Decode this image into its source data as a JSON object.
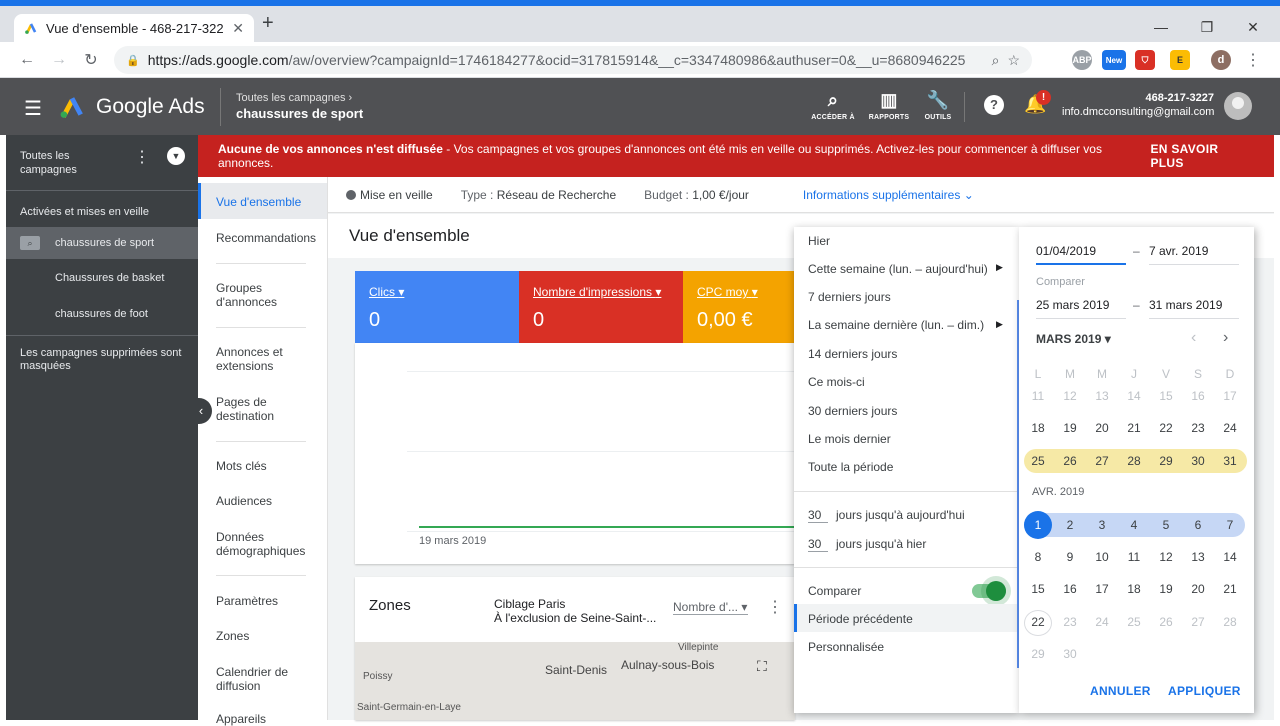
{
  "browser": {
    "tab_title": "Vue d'ensemble - 468-217-3227",
    "new_tab": "+",
    "url_base": "https://ads.google.com",
    "url_rest": "/aw/overview?campaignId=1746184277&ocid=317815914&__c=3347480986&authuser=0&__u=8680946225",
    "ext_new": "New",
    "profile": "d"
  },
  "header": {
    "app_name": "Google Ads",
    "breadcrumb_parent": "Toutes les campagnes",
    "breadcrumb_current": "chaussures de sport",
    "tools": [
      {
        "label": "ACCÉDER À",
        "icon": "search-icon"
      },
      {
        "label": "RAPPORTS",
        "icon": "reports-icon"
      },
      {
        "label": "OUTILS",
        "icon": "tools-icon"
      }
    ],
    "account_id": "468-217-3227",
    "account_email": "info.dmcconsulting@gmail.com",
    "notif_badge": "!"
  },
  "leftnav": {
    "all_campaigns_line1": "Toutes les",
    "all_campaigns_line2": "campagnes",
    "section": "Activées et mises en veille",
    "campaign_active": "chaussures de sport",
    "campaign_2": "Chaussures de basket",
    "campaign_3": "chaussures de foot",
    "removed_line1": "Les campagnes supprimées sont",
    "removed_line2": "masquées"
  },
  "alert": {
    "bold": "Aucune de vos annonces n'est diffusée",
    "text": " - Vos campagnes et vos groupes d'annonces ont été mis en veille ou supprimés. Activez-les pour commencer à diffuser vos annonces.",
    "link": "EN SAVOIR PLUS"
  },
  "subnav": [
    "Vue d'ensemble",
    "Recommandations",
    "Groupes d'annonces",
    "Annonces et extensions",
    "Pages de destination",
    "Mots clés",
    "Audiences",
    "Données démographiques",
    "Paramètres",
    "Zones",
    "Calendrier de diffusion",
    "Appareils"
  ],
  "status": {
    "state": "Mise en veille",
    "type_label": "Type : ",
    "type_value": "Réseau de Recherche",
    "budget_label": "Budget : ",
    "budget_value": "1,00 €/jour",
    "more": "Informations supplémentaires"
  },
  "page_title": "Vue d'ensemble",
  "metrics": [
    {
      "label": "Clics",
      "value": "0",
      "color": "#4285f4"
    },
    {
      "label": "Nombre d'impressions",
      "value": "0",
      "color": "#d93025"
    },
    {
      "label": "CPC moy",
      "value": "0,00 €",
      "color": "#f4a300"
    }
  ],
  "chart": {
    "date_label": "19 mars 2019",
    "line_color": "#34a853"
  },
  "zones": {
    "title": "Zones",
    "target_line1": "Ciblage Paris",
    "target_line2": "À l'exclusion de Seine-Saint-...",
    "metric_select": "Nombre d'...",
    "map_labels": [
      "Villepinte",
      "Saint-Denis",
      "Aulnay-sous-Bois",
      "Poissy",
      "Saint-Germain-en-Laye"
    ]
  },
  "presets": {
    "items": [
      {
        "label": "Hier",
        "arrow": false
      },
      {
        "label": "Cette semaine (lun. – aujourd'hui)",
        "arrow": true
      },
      {
        "label": "7 derniers jours",
        "arrow": false
      },
      {
        "label": "La semaine dernière (lun. – dim.)",
        "arrow": true
      },
      {
        "label": "14 derniers jours",
        "arrow": false
      },
      {
        "label": "Ce mois-ci",
        "arrow": false
      },
      {
        "label": "30 derniers jours",
        "arrow": false
      },
      {
        "label": "Le mois dernier",
        "arrow": false
      },
      {
        "label": "Toute la période",
        "arrow": false
      }
    ],
    "days_1": "30",
    "days_1_label": "jours jusqu'à aujourd'hui",
    "days_2": "30",
    "days_2_label": "jours jusqu'à hier",
    "compare": "Comparer",
    "compare_on": true,
    "previous": "Période précédente",
    "custom": "Personnalisée"
  },
  "calendar": {
    "start": "01/04/2019",
    "end": "7 avr. 2019",
    "compare_label": "Comparer",
    "compare_start": "25 mars 2019",
    "compare_end": "31 mars 2019",
    "dash": "–",
    "month_selector": "MARS 2019",
    "weekdays": [
      "L",
      "M",
      "M",
      "J",
      "V",
      "S",
      "D"
    ],
    "march_rows": [
      [
        "11",
        "12",
        "13",
        "14",
        "15",
        "16",
        "17"
      ],
      [
        "18",
        "19",
        "20",
        "21",
        "22",
        "23",
        "24"
      ],
      [
        "25",
        "26",
        "27",
        "28",
        "29",
        "30",
        "31"
      ]
    ],
    "april_label": "AVR. 2019",
    "april_rows": [
      [
        "1",
        "2",
        "3",
        "4",
        "5",
        "6",
        "7"
      ],
      [
        "8",
        "9",
        "10",
        "11",
        "12",
        "13",
        "14"
      ],
      [
        "15",
        "16",
        "17",
        "18",
        "19",
        "20",
        "21"
      ],
      [
        "22",
        "23",
        "24",
        "25",
        "26",
        "27",
        "28"
      ],
      [
        "29",
        "30"
      ]
    ],
    "compare_color": "#f6e9a6",
    "range_color": "#c6d7f5",
    "accent": "#1a73e8",
    "cancel": "ANNULER",
    "apply": "APPLIQUER"
  }
}
